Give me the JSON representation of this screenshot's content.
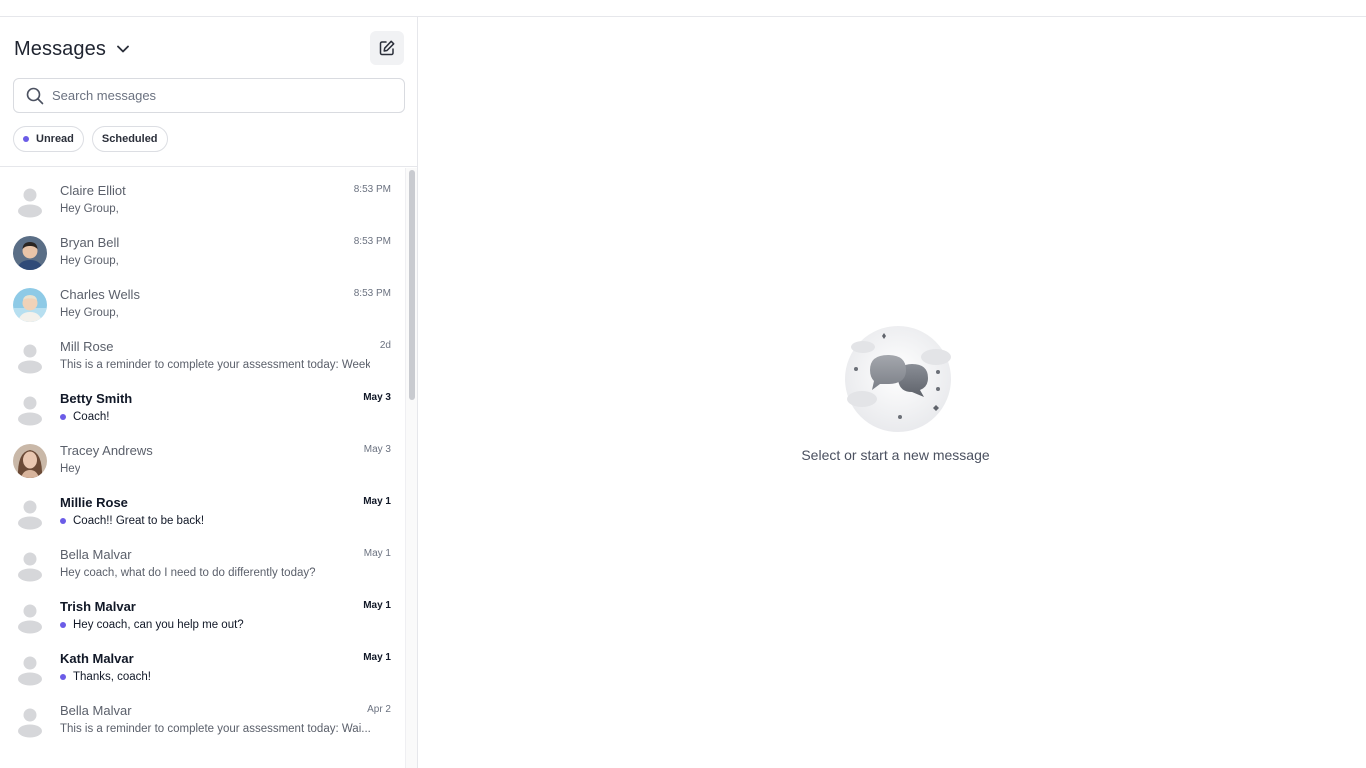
{
  "sidebar": {
    "title": "Messages",
    "search": {
      "placeholder": "Search messages"
    },
    "filters": [
      {
        "label": "Unread"
      },
      {
        "label": "Scheduled"
      }
    ],
    "conversations": [
      {
        "name": "Claire Elliot",
        "preview": "Hey Group,",
        "time": "8:53 PM",
        "unread": false,
        "avatar": "placeholder"
      },
      {
        "name": "Bryan Bell",
        "preview": "Hey Group,",
        "time": "8:53 PM",
        "unread": false,
        "avatar": "photo"
      },
      {
        "name": "Charles Wells",
        "preview": "Hey Group,",
        "time": "8:53 PM",
        "unread": false,
        "avatar": "photo"
      },
      {
        "name": "Mill Rose",
        "preview": "This is a reminder to complete your assessment today: Week...",
        "time": "2d",
        "unread": false,
        "avatar": "placeholder"
      },
      {
        "name": "Betty Smith",
        "preview": "Coach!",
        "time": "May 3",
        "unread": true,
        "avatar": "placeholder"
      },
      {
        "name": "Tracey Andrews",
        "preview": "Hey",
        "time": "May 3",
        "unread": false,
        "avatar": "photo"
      },
      {
        "name": "Millie Rose",
        "preview": "Coach!! Great to be back!",
        "time": "May 1",
        "unread": true,
        "avatar": "placeholder"
      },
      {
        "name": "Bella Malvar",
        "preview": "Hey coach, what do I need to do differently today?",
        "time": "May 1",
        "unread": false,
        "avatar": "placeholder"
      },
      {
        "name": "Trish Malvar",
        "preview": "Hey coach, can you help me out?",
        "time": "May 1",
        "unread": true,
        "avatar": "placeholder"
      },
      {
        "name": "Kath Malvar",
        "preview": "Thanks, coach!",
        "time": "May 1",
        "unread": true,
        "avatar": "placeholder"
      },
      {
        "name": "Bella Malvar",
        "preview": "This is a reminder to complete your assessment today: Wai...",
        "time": "Apr 2",
        "unread": false,
        "avatar": "placeholder"
      }
    ]
  },
  "main": {
    "empty_text": "Select or start a new message"
  },
  "colors": {
    "accent": "#6b5ce7",
    "border": "#e6e7eb",
    "text_primary": "#111827",
    "text_muted": "#5b606b"
  },
  "icons": {
    "title_dropdown": "chevron-down-icon",
    "compose": "compose-icon",
    "search": "search-icon",
    "avatar_placeholder": "user-placeholder-icon",
    "empty_state": "chat-bubbles-illustration"
  }
}
